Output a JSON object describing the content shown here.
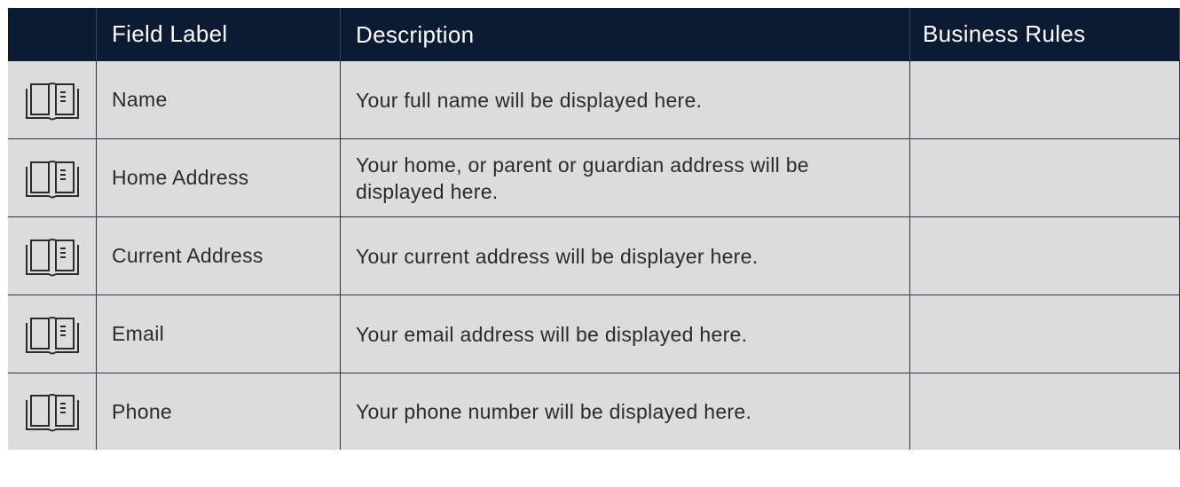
{
  "table": {
    "headers": {
      "icon": "",
      "field_label": "Field Label",
      "description": "Description",
      "business_rules": "Business Rules"
    },
    "rows": [
      {
        "icon": "book-icon",
        "field_label": "Name",
        "description": "Your full name will be displayed here.",
        "business_rules": ""
      },
      {
        "icon": "book-icon",
        "field_label": "Home Address",
        "description": "Your home, or parent or guardian address will be displayed here.",
        "business_rules": ""
      },
      {
        "icon": "book-icon",
        "field_label": "Current Address",
        "description": "Your current address will be displayer here.",
        "business_rules": ""
      },
      {
        "icon": "book-icon",
        "field_label": "Email",
        "description": "Your email address will be displayed here.",
        "business_rules": ""
      },
      {
        "icon": "book-icon",
        "field_label": "Phone",
        "description": "Your phone number will be displayed here.",
        "business_rules": ""
      }
    ]
  },
  "colors": {
    "header_bg": "#0d1a33",
    "header_text": "#ffffff",
    "body_bg": "#dcdcdc",
    "body_text": "#2b2b2b",
    "grid_line": "#27304f"
  }
}
